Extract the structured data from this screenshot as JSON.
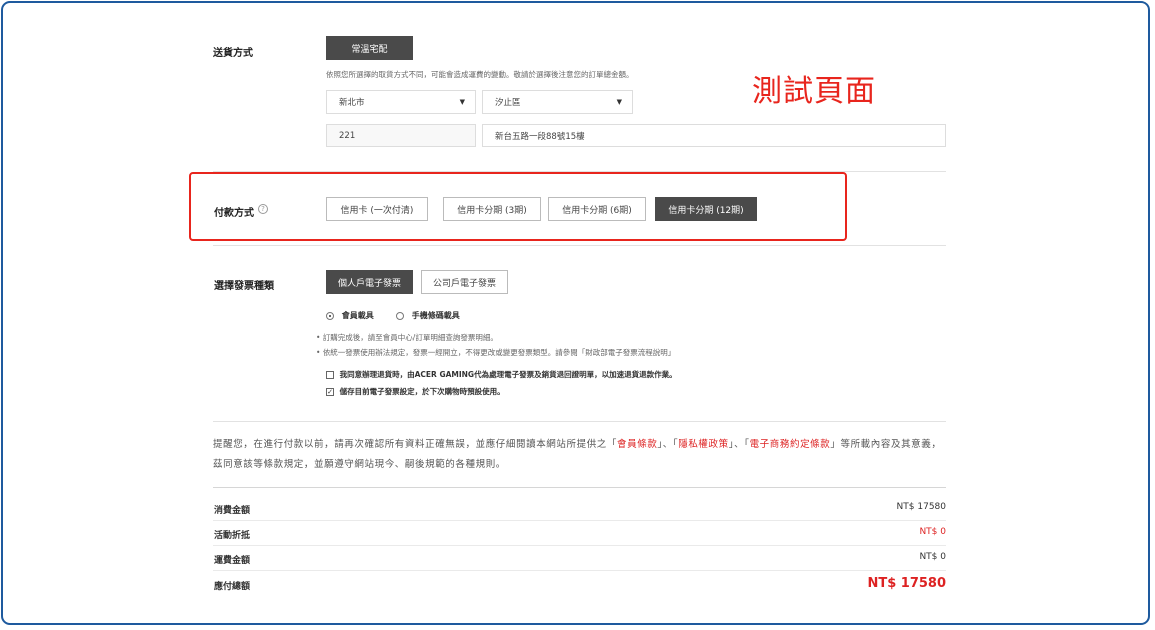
{
  "shipping": {
    "label": "送貨方式",
    "method_button": "常溫宅配",
    "note": "依照您所選擇的取貨方式不同，可能會造成運費的變動。敬請於選擇後注意您的訂單總金額。",
    "city": "新北市",
    "district": "汐止區",
    "zip": "221",
    "address": "新台五路一段88號15樓"
  },
  "test_banner": "測試頁面",
  "payment": {
    "label": "付款方式",
    "options": [
      "信用卡 (一次付清)",
      "信用卡分期 (3期)",
      "信用卡分期 (6期)",
      "信用卡分期 (12期)"
    ],
    "selected_index": 3
  },
  "invoice": {
    "label": "選擇發票種類",
    "types": [
      "個人戶電子發票",
      "公司戶電子發票"
    ],
    "carrier_member": "會員載具",
    "carrier_mobile": "手機條碼載具",
    "bullet1": "訂購完成後，請至會員中心/訂單明細查詢發票明細。",
    "bullet2": "依統一發票使用辦法規定，發票一經開立，不得更改或變更發票類型。請參閱「財政部電子發票流程說明」",
    "agree_return": "我同意辦理退貨時，由ACER GAMING代為處理電子發票及銷貨退回證明單，以加速退貨退款作業。",
    "save_setting": "儲存目前電子發票設定，於下次購物時預設使用。"
  },
  "notice": {
    "prefix": "提醒您，在進行付款以前，請再次確認所有資料正確無誤，並應仔細閱讀本網站所提供之「",
    "link1": "會員條款",
    "sep1": "」、「",
    "link2": "隱私權政策",
    "sep2": "」、「",
    "link3": "電子商務約定條款",
    "suffix": "」等所載內容及其意義，",
    "line2": "茲同意該等條款規定，並願遵守網站現今、嗣後規範的各種規則。"
  },
  "summary": {
    "subtotal_label": "消費金額",
    "subtotal_value": "NT$ 17580",
    "discount_label": "活動折抵",
    "discount_value": "NT$ 0",
    "shipping_label": "運費金額",
    "shipping_value": "NT$ 0",
    "total_label": "應付總額",
    "total_value": "NT$ 17580"
  },
  "colors": {
    "frame": "#1e5a9e",
    "highlight": "#e8251d",
    "active_button": "#4a4a4a",
    "price_red": "#dd2222"
  }
}
